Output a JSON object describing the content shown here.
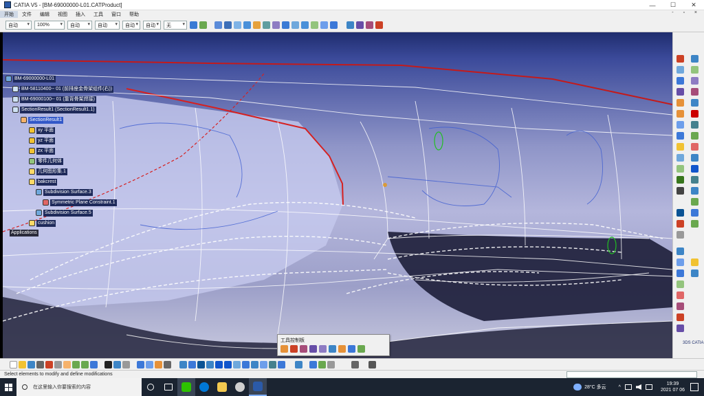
{
  "window": {
    "title": "CATIA V5 - [BM-69000000-L01.CATProduct]",
    "controls": [
      "—",
      "☐",
      "✕"
    ]
  },
  "menubar": {
    "items": [
      "开始",
      "文件",
      "编辑",
      "视图",
      "插入",
      "工具",
      "窗口",
      "帮助"
    ],
    "mdi_controls": "- ▫ ×"
  },
  "toolbar": {
    "combo_1": "自动",
    "combo_2": "100%",
    "combo_3": "自动",
    "combo_4": "自动",
    "combo_5": "自动",
    "combo_6": "自动",
    "combo_7": "无"
  },
  "spec_tree": {
    "root": "BM-69000000-L01",
    "part_1": "BM-58110400-- 01 (前排座金骨架组件(右))",
    "part_2": "BM-69000100-- 01 (靠背骨架焊接)",
    "section_result": "SectionResult1 (SectionResult1.1)",
    "section_result_node": "SectionResult1",
    "xy_plane": "xy 平面",
    "yz_plane": "yz 平面",
    "zx_plane": "zx 平面",
    "part_body": "零件几何体",
    "geo_set": "几何图形集.1",
    "backrest": "bakcrest",
    "subdivision_1": "Subdivision Surface.3",
    "symmetric": "Symmetric Plane Constraint.1",
    "subdivision_2": "Subdivision Surface.5",
    "cushion": "cushion",
    "applications": "Applications"
  },
  "floating_toolbar": {
    "title": "工具控制板"
  },
  "statusbar": {
    "text": "Select elements to modify and define modifications"
  },
  "taskbar": {
    "search_placeholder": "在这里输入你要搜索的内容",
    "weather": "28°C 多云",
    "time": "19:39",
    "date": "2021 07 06"
  },
  "logo_text": "3DS CATIA"
}
